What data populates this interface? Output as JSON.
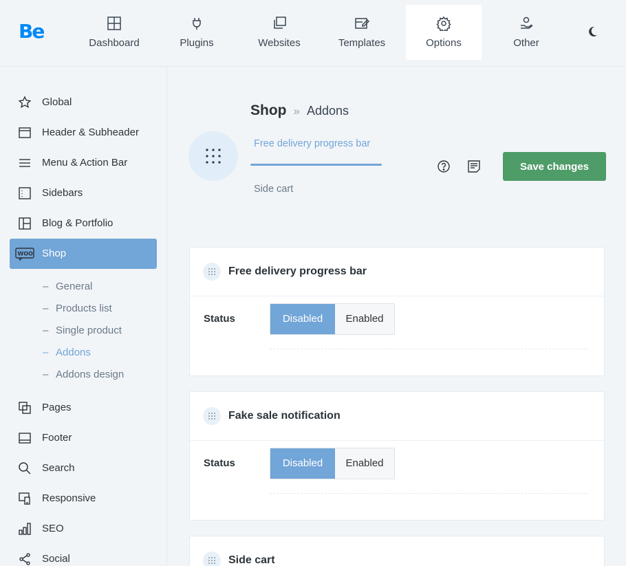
{
  "logo": "Be",
  "nav": [
    {
      "label": "Dashboard",
      "icon": "dashboard-icon"
    },
    {
      "label": "Plugins",
      "icon": "plug-icon"
    },
    {
      "label": "Websites",
      "icon": "websites-icon"
    },
    {
      "label": "Templates",
      "icon": "templates-icon"
    },
    {
      "label": "Options",
      "icon": "gear-icon",
      "active": true
    },
    {
      "label": "Other",
      "icon": "hand-user-icon"
    }
  ],
  "sidebar": {
    "items": [
      {
        "label": "Global",
        "icon": "star-icon"
      },
      {
        "label": "Header & Subheader",
        "icon": "header-icon"
      },
      {
        "label": "Menu & Action Bar",
        "icon": "menu-icon"
      },
      {
        "label": "Sidebars",
        "icon": "sidebars-icon"
      },
      {
        "label": "Blog & Portfolio",
        "icon": "blog-icon"
      },
      {
        "label": "Shop",
        "icon": "woo-icon",
        "active": true
      },
      {
        "label": "Pages",
        "icon": "pages-icon"
      },
      {
        "label": "Footer",
        "icon": "footer-icon"
      },
      {
        "label": "Search",
        "icon": "search-icon"
      },
      {
        "label": "Responsive",
        "icon": "responsive-icon"
      },
      {
        "label": "SEO",
        "icon": "seo-icon"
      },
      {
        "label": "Social",
        "icon": "share-icon"
      }
    ],
    "shop_sub": [
      {
        "label": "General"
      },
      {
        "label": "Products list"
      },
      {
        "label": "Single product"
      },
      {
        "label": "Addons",
        "active": true
      },
      {
        "label": "Addons design"
      }
    ]
  },
  "header": {
    "title": "Shop",
    "separator": "»",
    "subtitle": "Addons",
    "tabs": [
      "Free delivery progress bar",
      "Side cart"
    ],
    "save_label": "Save changes"
  },
  "cards": [
    {
      "title": "Free delivery progress bar",
      "status_label": "Status",
      "options": [
        "Disabled",
        "Enabled"
      ],
      "selected": "Disabled"
    },
    {
      "title": "Fake sale notification",
      "status_label": "Status",
      "options": [
        "Disabled",
        "Enabled"
      ],
      "selected": "Disabled"
    },
    {
      "title": "Side cart"
    }
  ],
  "colors": {
    "accent": "#72a5d8",
    "save": "#4e9c68",
    "logo": "#0089f7"
  }
}
